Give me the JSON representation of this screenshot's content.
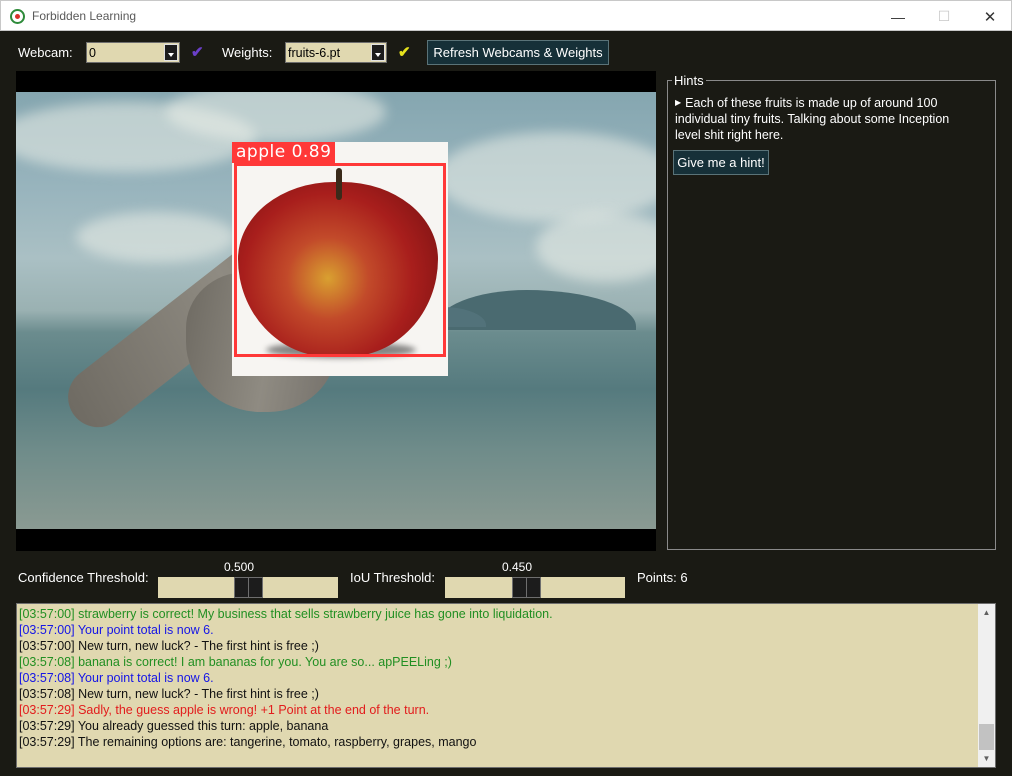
{
  "window": {
    "title": "Forbidden Learning"
  },
  "toolbar": {
    "webcam_label": "Webcam:",
    "webcam_value": "0",
    "webcam_check": "✔",
    "weights_label": "Weights:",
    "weights_value": "fruits-6.pt",
    "weights_check": "✔",
    "refresh_label": "Refresh Webcams & Weights"
  },
  "video": {
    "detection_label": "apple  0.89",
    "detection_class": "apple",
    "detection_confidence": 0.89
  },
  "hints": {
    "title": "Hints",
    "text": "Each of these fruits is made up of around 100 individual tiny fruits. Talking about some Inception level shit right here.",
    "button_label": "Give me a hint!"
  },
  "controls": {
    "confidence_label": "Confidence Threshold:",
    "confidence_value": "0.500",
    "confidence_fraction": 0.5,
    "iou_label": "IoU Threshold:",
    "iou_value": "0.450",
    "iou_fraction": 0.45,
    "points_label": "Points: 6"
  },
  "colors": {
    "green": "#218f22",
    "blue": "#1515e6",
    "black": "#111111",
    "red": "#e21c1c",
    "panel_bg": "#e0d8b0",
    "window_bg": "#1a1a14",
    "box": "#ff3838"
  },
  "log": [
    {
      "text": "[03:57:00] strawberry is correct! My business that sells strawberry juice has gone into liquidation.",
      "color": "green"
    },
    {
      "text": "[03:57:00] Your point total is now 6.",
      "color": "blue"
    },
    {
      "text": "[03:57:00] New turn, new luck? - The first hint is free ;)",
      "color": "black"
    },
    {
      "text": "[03:57:08] banana is correct! I am bananas for you. You are so... apPEELing ;)",
      "color": "green"
    },
    {
      "text": "[03:57:08] Your point total is now 6.",
      "color": "blue"
    },
    {
      "text": "[03:57:08] New turn, new luck? - The first hint is free ;)",
      "color": "black"
    },
    {
      "text": "[03:57:29] Sadly, the guess apple is wrong! +1 Point at the end of the turn.",
      "color": "red"
    },
    {
      "text": "[03:57:29] You already guessed this turn: apple, banana",
      "color": "black"
    },
    {
      "text": "[03:57:29] The remaining options are: tangerine, tomato, raspberry, grapes, mango",
      "color": "black"
    }
  ]
}
